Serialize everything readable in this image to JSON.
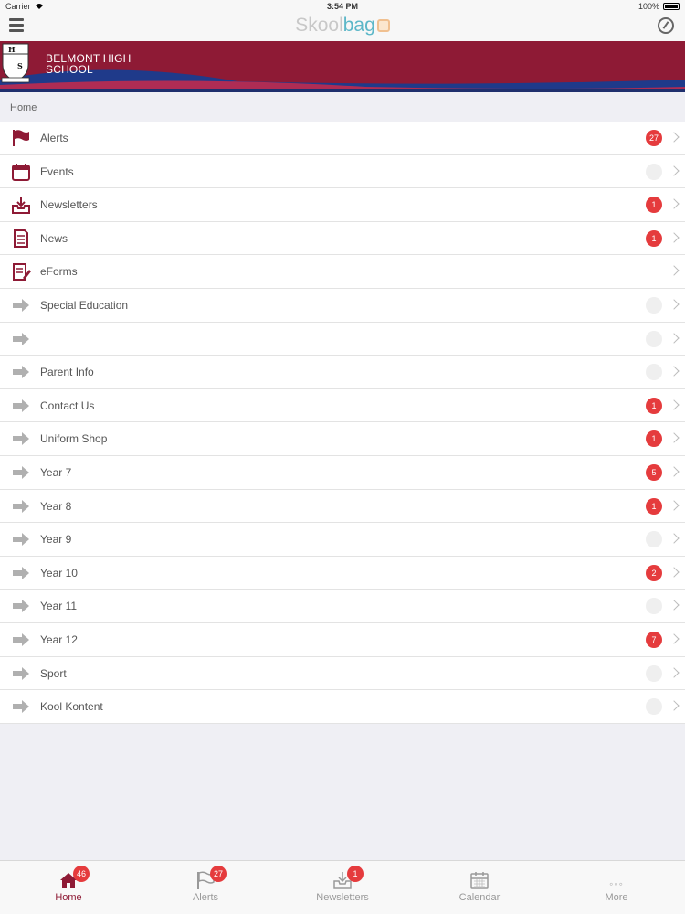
{
  "status": {
    "carrier": "Carrier",
    "time": "3:54 PM",
    "battery": "100%"
  },
  "brand": {
    "part1": "Skool",
    "part2": "bag"
  },
  "school": {
    "line1": "BELMONT HIGH",
    "line2": "SCHOOL"
  },
  "breadcrumb": "Home",
  "menu": [
    {
      "label": "Alerts",
      "icon": "flag-icon",
      "badge": "27"
    },
    {
      "label": "Events",
      "icon": "calendar-icon",
      "badge": ""
    },
    {
      "label": "Newsletters",
      "icon": "inbox-download-icon",
      "badge": "1"
    },
    {
      "label": "News",
      "icon": "document-icon",
      "badge": "1"
    },
    {
      "label": "eForms",
      "icon": "form-pencil-icon",
      "badge": null
    },
    {
      "label": "Special Education",
      "icon": "arrow-icon",
      "badge": ""
    },
    {
      "label": "",
      "icon": "arrow-icon",
      "badge": ""
    },
    {
      "label": "Parent Info",
      "icon": "arrow-icon",
      "badge": ""
    },
    {
      "label": "Contact Us",
      "icon": "arrow-icon",
      "badge": "1"
    },
    {
      "label": "Uniform Shop",
      "icon": "arrow-icon",
      "badge": "1"
    },
    {
      "label": "Year 7",
      "icon": "arrow-icon",
      "badge": "5"
    },
    {
      "label": "Year 8",
      "icon": "arrow-icon",
      "badge": "1"
    },
    {
      "label": "Year 9",
      "icon": "arrow-icon",
      "badge": ""
    },
    {
      "label": "Year 10",
      "icon": "arrow-icon",
      "badge": "2"
    },
    {
      "label": "Year 11",
      "icon": "arrow-icon",
      "badge": ""
    },
    {
      "label": "Year 12",
      "icon": "arrow-icon",
      "badge": "7"
    },
    {
      "label": "Sport",
      "icon": "arrow-icon",
      "badge": ""
    },
    {
      "label": "Kool Kontent",
      "icon": "arrow-icon",
      "badge": ""
    }
  ],
  "tabs": [
    {
      "label": "Home",
      "icon": "home-icon",
      "badge": "46",
      "active": true
    },
    {
      "label": "Alerts",
      "icon": "flag-icon",
      "badge": "27",
      "active": false
    },
    {
      "label": "Newsletters",
      "icon": "inbox-download-icon",
      "badge": "1",
      "active": false
    },
    {
      "label": "Calendar",
      "icon": "calendar-icon",
      "badge": null,
      "active": false
    },
    {
      "label": "More",
      "icon": "more-dots-icon",
      "badge": null,
      "active": false
    }
  ],
  "colors": {
    "brand_maroon": "#8e1a35",
    "badge_red": "#e53b3d",
    "brand_teal": "#5cb7c8"
  }
}
